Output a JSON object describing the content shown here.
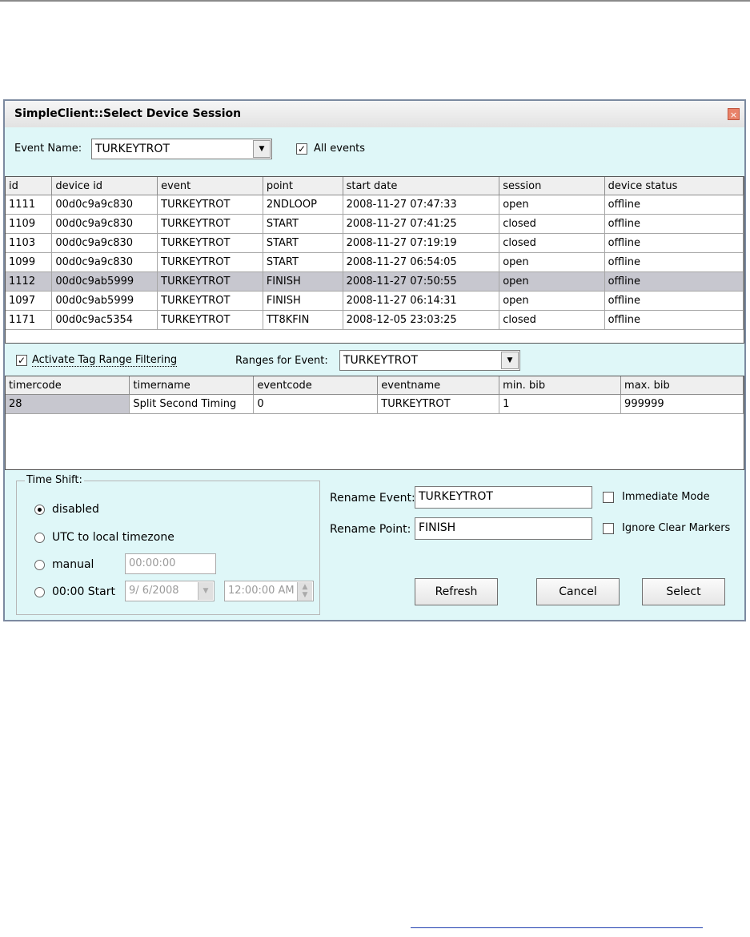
{
  "window": {
    "title": "SimpleClient::Select Device Session",
    "close_glyph": "×"
  },
  "event_filter": {
    "label": "Event Name:",
    "value": "TURKEYTROT",
    "all_events_label": "All events",
    "all_events_checked": true
  },
  "sessions": {
    "columns": [
      "id",
      "device id",
      "event",
      "point",
      "start date",
      "session",
      "device status"
    ],
    "rows": [
      [
        "1111",
        "00d0c9a9c830",
        "TURKEYTROT",
        "2NDLOOP",
        "2008-11-27 07:47:33",
        "open",
        "offline"
      ],
      [
        "1109",
        "00d0c9a9c830",
        "TURKEYTROT",
        "START",
        "2008-11-27 07:41:25",
        "closed",
        "offline"
      ],
      [
        "1103",
        "00d0c9a9c830",
        "TURKEYTROT",
        "START",
        "2008-11-27 07:19:19",
        "closed",
        "offline"
      ],
      [
        "1099",
        "00d0c9a9c830",
        "TURKEYTROT",
        "START",
        "2008-11-27 06:54:05",
        "open",
        "offline"
      ],
      [
        "1112",
        "00d0c9ab5999",
        "TURKEYTROT",
        "FINISH",
        "2008-11-27 07:50:55",
        "open",
        "offline"
      ],
      [
        "1097",
        "00d0c9ab5999",
        "TURKEYTROT",
        "FINISH",
        "2008-11-27 06:14:31",
        "open",
        "offline"
      ],
      [
        "1171",
        "00d0c9ac5354",
        "TURKEYTROT",
        "TT8KFIN",
        "2008-12-05 23:03:25",
        "closed",
        "offline"
      ]
    ],
    "selected_row": 4
  },
  "tag_filter": {
    "label": "Activate Tag Range Filtering",
    "checked": true,
    "ranges_label": "Ranges for Event:",
    "ranges_value": "TURKEYTROT"
  },
  "ranges": {
    "columns": [
      "timercode",
      "timername",
      "eventcode",
      "eventname",
      "min. bib",
      "max. bib"
    ],
    "rows": [
      [
        "28",
        "Split Second Timing",
        "0",
        "TURKEYTROT",
        "1",
        "999999"
      ]
    ]
  },
  "time_shift": {
    "title": "Time Shift:",
    "options": [
      "disabled",
      "UTC to local timezone",
      "manual",
      "00:00 Start"
    ],
    "selected": 0,
    "manual_value": "00:00:00",
    "start_date": "9/  6/2008",
    "start_time": "12:00:00 AM"
  },
  "rename": {
    "event_label": "Rename Event:",
    "event_value": "TURKEYTROT",
    "point_label": "Rename Point:",
    "point_value": "FINISH",
    "immediate_label": "Immediate Mode",
    "ignore_label": "Ignore Clear Markers"
  },
  "buttons": {
    "refresh": "Refresh",
    "cancel": "Cancel",
    "select": "Select"
  },
  "icons": {
    "dropdown": "chevron-down-icon",
    "check": "check-icon",
    "close": "close-icon"
  },
  "colors": {
    "window_bg": "#dff7f8",
    "selection": "#c7c7cf",
    "title_bar": "#e8e8e8"
  }
}
